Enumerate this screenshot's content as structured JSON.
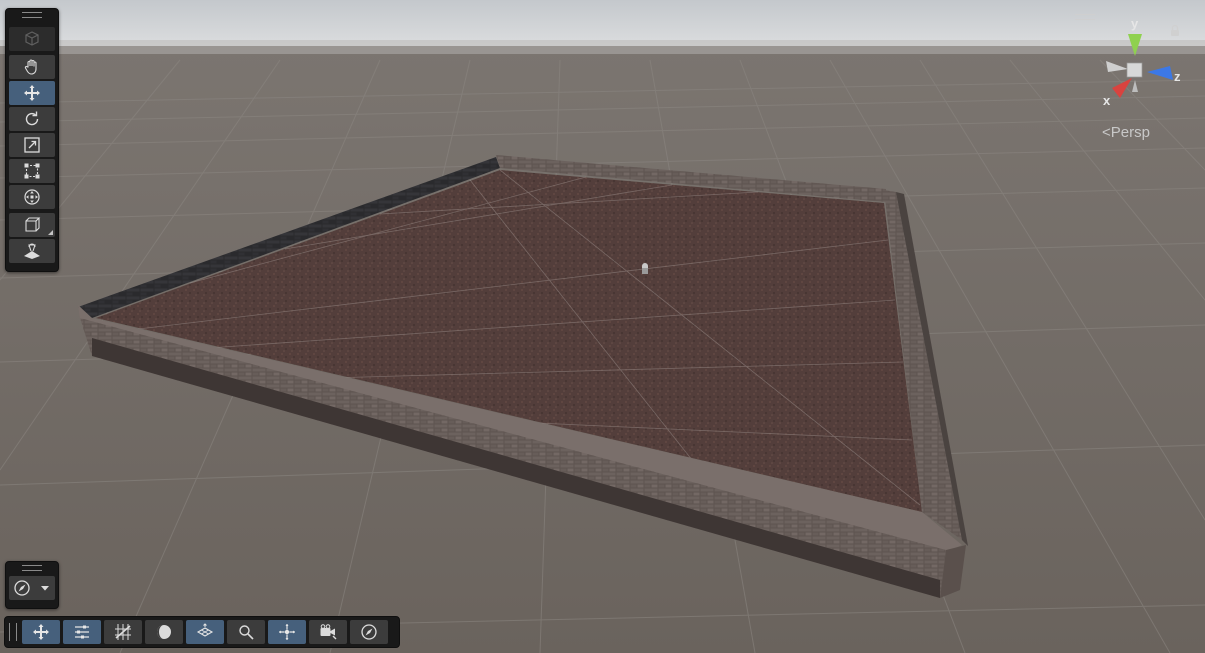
{
  "scene_view": {
    "projection_label": "Persp",
    "axis_labels": {
      "x": "x",
      "y": "y",
      "z": "z"
    }
  },
  "tools_overlay": {
    "items": [
      {
        "name": "view-tool",
        "icon": "hand-icon",
        "active": false
      },
      {
        "name": "move-tool",
        "icon": "move-arrows-icon",
        "active": true
      },
      {
        "name": "rotate-tool",
        "icon": "rotate-icon",
        "active": false
      },
      {
        "name": "scale-tool",
        "icon": "scale-icon",
        "active": false
      },
      {
        "name": "rect-tool",
        "icon": "rect-transform-icon",
        "active": false
      },
      {
        "name": "transform-tool",
        "icon": "transform-icon",
        "active": false
      },
      {
        "name": "custom-tool",
        "icon": "cube-outline-icon",
        "active": false
      },
      {
        "name": "navmesh-tool",
        "icon": "navmesh-icon",
        "active": false
      }
    ]
  },
  "bottom_toolbar": {
    "items": [
      {
        "name": "tool-handle-position",
        "icon": "move-arrows-icon",
        "active": true
      },
      {
        "name": "tool-settings",
        "icon": "sliders-icon",
        "active": true
      },
      {
        "name": "grid-snapping",
        "icon": "grid-snap-icon",
        "active": false
      },
      {
        "name": "draw-mode",
        "icon": "shading-icon",
        "active": false
      },
      {
        "name": "grid-visibility",
        "icon": "grid-plane-icon",
        "active": true
      },
      {
        "name": "search",
        "icon": "magnifier-icon",
        "active": false
      },
      {
        "name": "gizmos",
        "icon": "gizmo-icon",
        "active": true
      },
      {
        "name": "scene-camera",
        "icon": "camera-icon",
        "active": false
      },
      {
        "name": "orientation",
        "icon": "compass-icon",
        "active": false
      }
    ]
  },
  "colors": {
    "panel_bg": "#191919",
    "button_bg": "#3c3c3c",
    "active_button_bg": "#46607c",
    "ground": "#6f6760",
    "sky": "#d5d7d9",
    "x_axis": "#d9433f",
    "y_axis": "#8fd14f",
    "z_axis": "#3c78e6"
  }
}
